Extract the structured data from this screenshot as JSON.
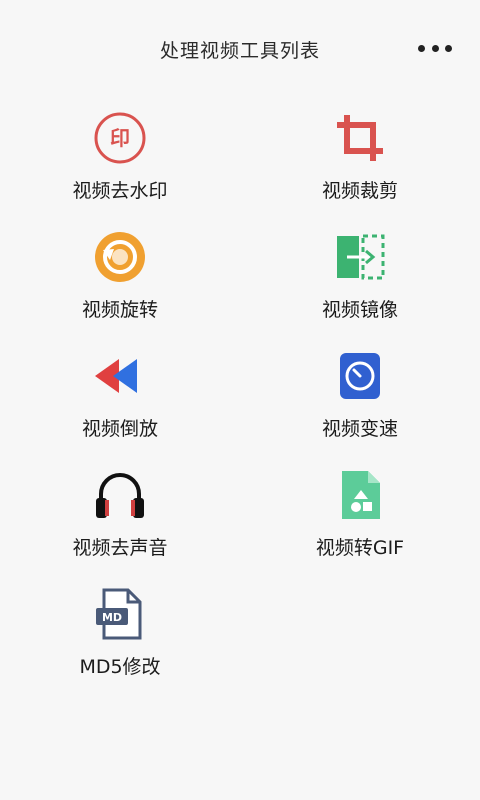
{
  "header": {
    "title": "处理视频工具列表"
  },
  "tools": [
    {
      "label": "视频去水印",
      "icon": "watermark-icon",
      "color": "#d9534f"
    },
    {
      "label": "视频裁剪",
      "icon": "crop-icon",
      "color": "#d9534f"
    },
    {
      "label": "视频旋转",
      "icon": "rotate-icon",
      "color": "#f0a030"
    },
    {
      "label": "视频镜像",
      "icon": "mirror-icon",
      "color": "#3cb371"
    },
    {
      "label": "视频倒放",
      "icon": "rewind-icon",
      "color": "#e04040"
    },
    {
      "label": "视频变速",
      "icon": "speed-icon",
      "color": "#3060d0"
    },
    {
      "label": "视频去声音",
      "icon": "headphones-icon",
      "color": "#d04040"
    },
    {
      "label": "视频转GIF",
      "icon": "gif-file-icon",
      "color": "#5ccc99"
    },
    {
      "label": "MD5修改",
      "icon": "md-file-icon",
      "color": "#4a5a78"
    }
  ]
}
